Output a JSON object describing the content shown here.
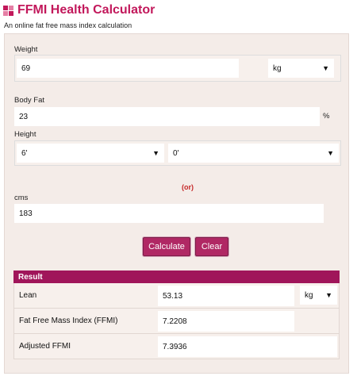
{
  "header": {
    "title": "FFMI Health Calculator",
    "subtitle": "An online fat free mass index calculation"
  },
  "form": {
    "weight_label": "Weight",
    "weight_value": "69",
    "weight_unit": "kg",
    "bodyfat_label": "Body Fat",
    "bodyfat_value": "23",
    "bodyfat_unit": "%",
    "height_label": "Height",
    "height_feet": "6'",
    "height_inches": "0'",
    "or_text": "(or)",
    "cms_label": "cms",
    "cms_value": "183"
  },
  "buttons": {
    "calculate": "Calculate",
    "clear": "Clear"
  },
  "result": {
    "title": "Result",
    "lean_label": "Lean",
    "lean_value": "53.13",
    "lean_unit": "kg",
    "ffmi_label": "Fat Free Mass Index (FFMI)",
    "ffmi_value": "7.2208",
    "adjusted_label": "Adjusted FFMI",
    "adjusted_value": "7.3936"
  },
  "colors": {
    "accent": "#c2185b",
    "button": "#b02864",
    "result_header": "#a0155a",
    "panel": "#f4ece8"
  },
  "icons": {
    "logo": "pink-grid-icon",
    "dropdown": "chevron-down-icon"
  }
}
